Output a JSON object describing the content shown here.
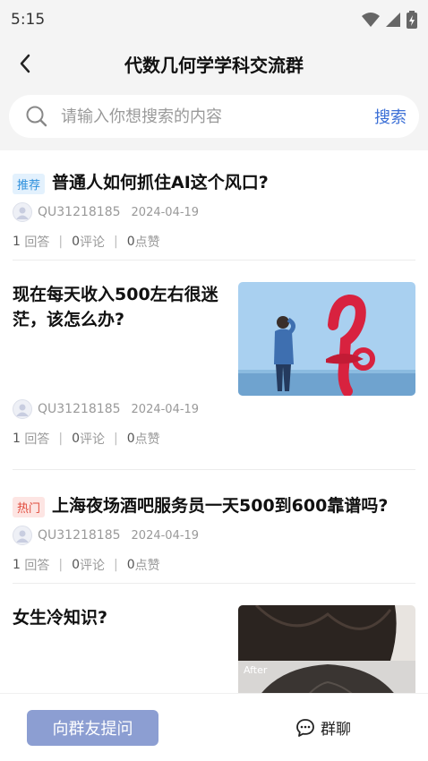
{
  "status_bar": {
    "time": "5:15"
  },
  "header": {
    "title": "代数几何学学科交流群"
  },
  "search": {
    "placeholder": "请输入你想搜索的内容",
    "button_label": "搜索"
  },
  "posts": [
    {
      "tag": "推荐",
      "title": "普通人如何抓住AI这个风口?",
      "author": "QU31218185",
      "date": "2024-04-19",
      "answers": "1",
      "answers_label": "回答",
      "comments": "0",
      "comments_label": "评论",
      "likes": "0",
      "likes_label": "点赞"
    },
    {
      "title": "现在每天收入500左右很迷茫，该怎么办?",
      "author": "QU31218185",
      "date": "2024-04-19",
      "answers": "1",
      "answers_label": "回答",
      "comments": "0",
      "comments_label": "评论",
      "likes": "0",
      "likes_label": "点赞"
    },
    {
      "tag": "热门",
      "title": "上海夜场酒吧服务员一天500到600靠谱吗?",
      "author": "QU31218185",
      "date": "2024-04-19",
      "answers": "1",
      "answers_label": "回答",
      "comments": "0",
      "comments_label": "评论",
      "likes": "0",
      "likes_label": "点赞"
    },
    {
      "title": "女生冷知识?",
      "image_caption": "After"
    }
  ],
  "bottom_bar": {
    "ask_label": "向群友提问",
    "chat_label": "群聊"
  },
  "colors": {
    "accent": "#3b6fd6",
    "ask_button": "#8c9ed2",
    "tag_recommend": "#2c8fdc",
    "tag_hot": "#e04a3b"
  }
}
